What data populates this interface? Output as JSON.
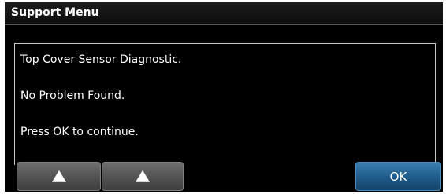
{
  "window": {
    "title": "Support Menu"
  },
  "message": {
    "lines": [
      "Top Cover Sensor Diagnostic.",
      "No Problem Found.",
      "Press OK to continue."
    ]
  },
  "buttons": {
    "ok_label": "OK",
    "up_icon": "up-arrow"
  },
  "colors": {
    "background": "#000000",
    "ok_button": "#1e5a8a",
    "up_button": "#5a5a5a"
  }
}
